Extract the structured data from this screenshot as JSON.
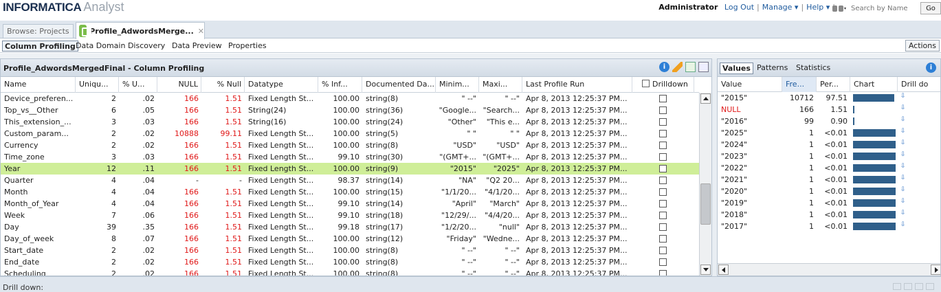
{
  "header": {
    "brand": "INFORMATICA",
    "product": "Analyst",
    "user": "Administrator",
    "logout": "Log Out",
    "manage": "Manage ▾",
    "help": "Help ▾",
    "search_placeholder": "Search by Name",
    "go": "Go"
  },
  "tabs": {
    "browse": "Browse: Projects",
    "profile": "Profile_AdwordsMerge...",
    "close": "✕"
  },
  "subnav": {
    "items": [
      "Column Profiling",
      "Data Domain Discovery",
      "Data Preview",
      "Properties"
    ],
    "actions": "Actions"
  },
  "left_panel": {
    "title": "Profile_AdwordsMergedFinal - Column Profiling",
    "columns": [
      "Name",
      "Uniqu...",
      "% U...",
      "NULL",
      "% Null",
      "Datatype",
      "% Inf...",
      "Documented Da...",
      "Minim...",
      "Maxi...",
      "Last Profile Run",
      "Drilldown"
    ],
    "rows": [
      [
        "Device_preferen...",
        "2",
        ".02",
        "166",
        "1.51",
        "Fixed Length St...",
        "100.00",
        "string(8)",
        "\" --\"",
        "\" --\"",
        "Apr 8, 2013 12:25:37 PM..."
      ],
      [
        "Top_vs__Other",
        "6",
        ".05",
        "166",
        "1.51",
        "String(24)",
        "100.00",
        "string(36)",
        "\"Google...",
        "\"Search...",
        "Apr 8, 2013 12:25:37 PM..."
      ],
      [
        "This_extension_...",
        "3",
        ".03",
        "166",
        "1.51",
        "String(16)",
        "100.00",
        "string(24)",
        "\"Other\"",
        "\"This e...",
        "Apr 8, 2013 12:25:37 PM..."
      ],
      [
        "Custom_param...",
        "2",
        ".02",
        "10888",
        "99.11",
        "Fixed Length St...",
        "100.00",
        "string(5)",
        "\" \"",
        "\" \"",
        "Apr 8, 2013 12:25:37 PM..."
      ],
      [
        "Currency",
        "2",
        ".02",
        "166",
        "1.51",
        "Fixed Length St...",
        "100.00",
        "string(8)",
        "\"USD\"",
        "\"USD\"",
        "Apr 8, 2013 12:25:37 PM..."
      ],
      [
        "Time_zone",
        "3",
        ".03",
        "166",
        "1.51",
        "Fixed Length St...",
        "99.10",
        "string(30)",
        "\"(GMT+...",
        "\"(GMT+...",
        "Apr 8, 2013 12:25:37 PM..."
      ],
      [
        "Year",
        "12",
        ".11",
        "166",
        "1.51",
        "Fixed Length St...",
        "100.00",
        "string(9)",
        "\"2015\"",
        "\"2025\"",
        "Apr 8, 2013 12:25:37 PM..."
      ],
      [
        "Quarter",
        "4",
        ".04",
        "-",
        "-",
        "Fixed Length St...",
        "98.37",
        "string(14)",
        "\"NA\"",
        "\"Q2 20...",
        "Apr 8, 2013 12:25:37 PM..."
      ],
      [
        "Month",
        "4",
        ".04",
        "166",
        "1.51",
        "Fixed Length St...",
        "100.00",
        "string(15)",
        "\"1/1/20...",
        "\"4/1/20...",
        "Apr 8, 2013 12:25:37 PM..."
      ],
      [
        "Month_of_Year",
        "4",
        ".04",
        "166",
        "1.51",
        "Fixed Length St...",
        "99.10",
        "string(14)",
        "\"April\"",
        "\"March\"",
        "Apr 8, 2013 12:25:37 PM..."
      ],
      [
        "Week",
        "7",
        ".06",
        "166",
        "1.51",
        "Fixed Length St...",
        "99.10",
        "string(18)",
        "\"12/29/...",
        "\"4/4/20...",
        "Apr 8, 2013 12:25:37 PM..."
      ],
      [
        "Day",
        "39",
        ".35",
        "166",
        "1.51",
        "Fixed Length St...",
        "99.18",
        "string(17)",
        "\"1/2/20...",
        "\"null\"",
        "Apr 8, 2013 12:25:37 PM..."
      ],
      [
        "Day_of_week",
        "8",
        ".07",
        "166",
        "1.51",
        "Fixed Length St...",
        "100.00",
        "string(12)",
        "\"Friday\"",
        "\"Wedne...",
        "Apr 8, 2013 12:25:37 PM..."
      ],
      [
        "Start_date",
        "2",
        ".02",
        "166",
        "1.51",
        "Fixed Length St...",
        "100.00",
        "string(8)",
        "\" --\"",
        "\" --\"",
        "Apr 8, 2013 12:25:37 PM..."
      ],
      [
        "End_date",
        "2",
        ".02",
        "166",
        "1.51",
        "Fixed Length St...",
        "100.00",
        "string(8)",
        "\" --\"",
        "\" --\"",
        "Apr 8, 2013 12:25:37 PM..."
      ],
      [
        "Scheduling",
        "2",
        ".02",
        "166",
        "1.51",
        "Fixed Length St...",
        "100.00",
        "string(8)",
        "\" --\"",
        "\" --\"",
        "Apr 8, 2013 12:25:37 PM..."
      ]
    ],
    "selected_row": 6
  },
  "right_panel": {
    "tabs": [
      "Values",
      "Patterns",
      "Statistics"
    ],
    "columns": [
      "Value",
      "Fre...",
      "Per...",
      "Chart",
      "Drill do"
    ],
    "rows": [
      [
        "\"2015\"",
        "10712",
        "97.51",
        0.9751
      ],
      [
        "NULL",
        "166",
        "1.51",
        0.0151
      ],
      [
        "\"2016\"",
        "99",
        "0.90",
        0.009
      ],
      [
        "\"2025\"",
        "1",
        "<0.01",
        1
      ],
      [
        "\"2024\"",
        "1",
        "<0.01",
        1
      ],
      [
        "\"2023\"",
        "1",
        "<0.01",
        1
      ],
      [
        "\"2022\"",
        "1",
        "<0.01",
        1
      ],
      [
        "\"2021\"",
        "1",
        "<0.01",
        1
      ],
      [
        "\"2020\"",
        "1",
        "<0.01",
        1
      ],
      [
        "\"2019\"",
        "1",
        "<0.01",
        1
      ],
      [
        "\"2018\"",
        "1",
        "<0.01",
        1
      ],
      [
        "\"2017\"",
        "1",
        "<0.01",
        1
      ]
    ],
    "drill_glyph": "⇩"
  },
  "footer": {
    "label": "Drill down:"
  },
  "colors": {
    "selected_row": "#cfee98",
    "null_red": "#e01818",
    "bar": "#2f5f8a",
    "link": "#1f5b9e"
  }
}
